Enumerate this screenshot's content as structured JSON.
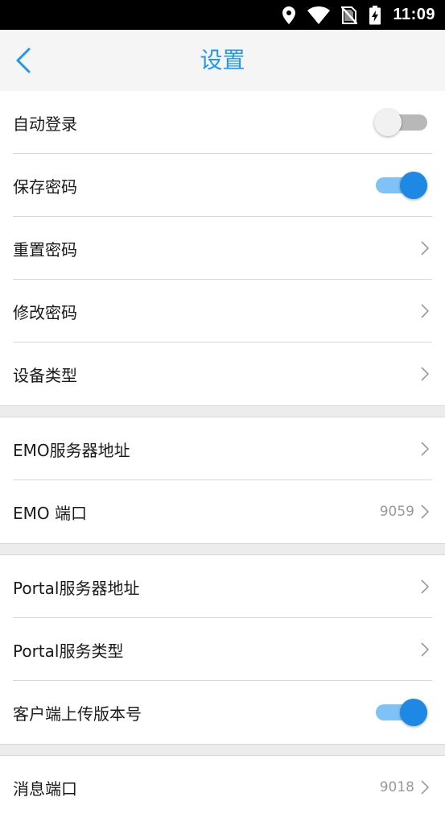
{
  "status_bar": {
    "time": "11:09",
    "icons": [
      "location-icon",
      "wifi-icon",
      "no-sim-icon",
      "battery-charging-icon"
    ]
  },
  "header": {
    "title": "设置",
    "back_icon": "chevron-left-icon"
  },
  "colors": {
    "accent": "#2196f3",
    "toggle_on": "#1e88e5",
    "toggle_track_on": "#7fc2f7",
    "toggle_off": "#b8b8b8"
  },
  "settings": {
    "auto_login": {
      "label": "自动登录",
      "enabled": false
    },
    "save_password": {
      "label": "保存密码",
      "enabled": true
    },
    "reset_password": {
      "label": "重置密码"
    },
    "change_password": {
      "label": "修改密码"
    },
    "device_type": {
      "label": "设备类型"
    },
    "emo_server_address": {
      "label": "EMO服务器地址"
    },
    "emo_port": {
      "label": "EMO 端口",
      "value": "9059"
    },
    "portal_server_address": {
      "label": "Portal服务器地址"
    },
    "portal_service_type": {
      "label": "Portal服务类型"
    },
    "client_upload_version": {
      "label": "客户端上传版本号",
      "enabled": true
    },
    "message_port": {
      "label": "消息端口",
      "value": "9018"
    }
  }
}
